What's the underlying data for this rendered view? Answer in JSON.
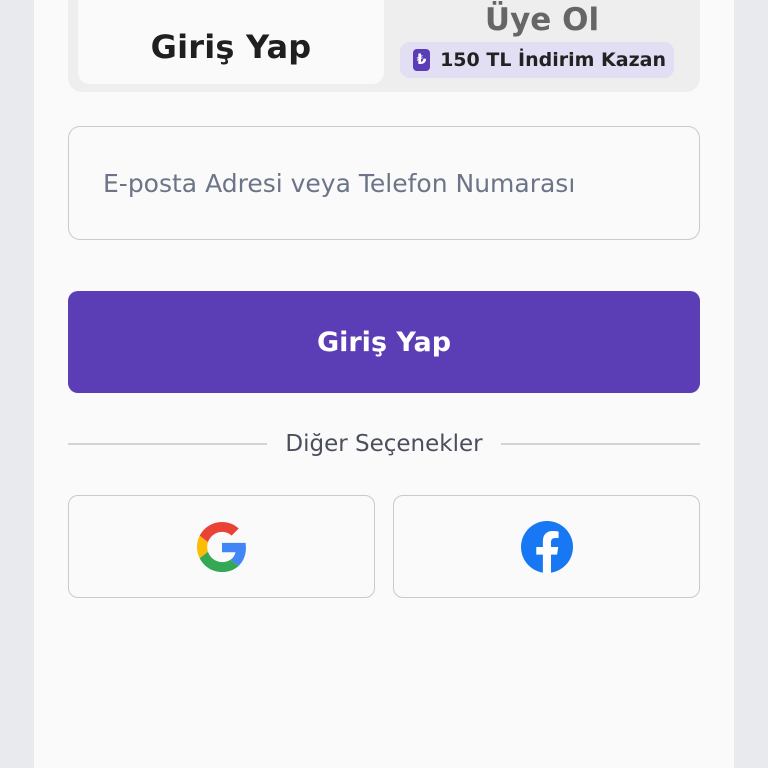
{
  "tabs": {
    "login_label": "Giriş Yap",
    "signup_label": "Üye Ol",
    "promo_icon_glyph": "₺",
    "promo_text": "150 TL İndirim Kazan"
  },
  "form": {
    "identifier_placeholder": "E-posta Adresi veya Telefon Numarası",
    "identifier_value": "",
    "submit_label": "Giriş Yap"
  },
  "divider": {
    "text": "Diğer Seçenekler"
  },
  "social": [
    {
      "provider": "google",
      "icon": "google-icon"
    },
    {
      "provider": "facebook",
      "icon": "facebook-icon"
    }
  ],
  "colors": {
    "brand_purple": "#5b3db5",
    "promo_badge_bg": "#e2def3",
    "panel_bg": "#fafafa",
    "page_bg": "#e9eaee",
    "facebook_blue": "#1877f2",
    "google_blue": "#4285f4",
    "google_red": "#ea4335",
    "google_yellow": "#fbbc05",
    "google_green": "#34a853"
  }
}
